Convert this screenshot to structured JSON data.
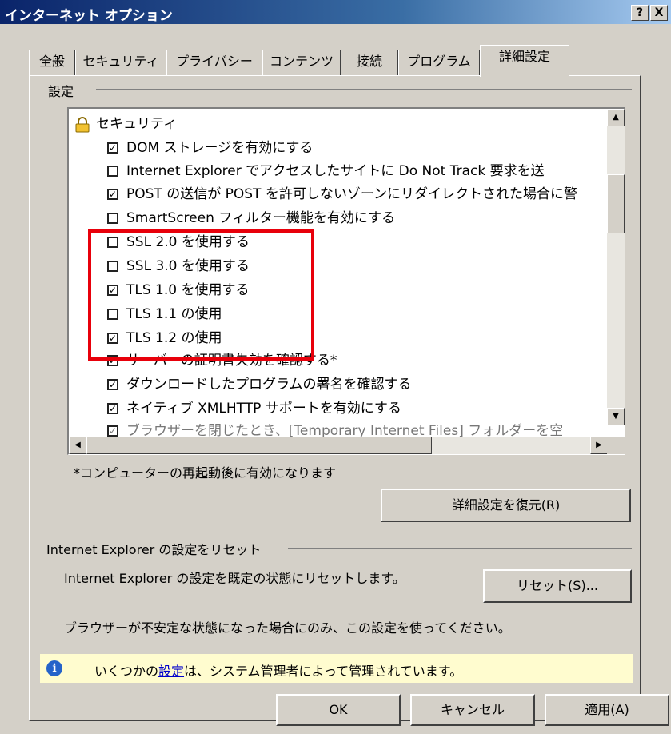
{
  "window": {
    "title": "インターネット オプション",
    "help_button": "?",
    "close_button": "X"
  },
  "tabs": [
    {
      "label": "全般",
      "active": false
    },
    {
      "label": "セキュリティ",
      "active": false
    },
    {
      "label": "プライバシー",
      "active": false
    },
    {
      "label": "コンテンツ",
      "active": false
    },
    {
      "label": "接続",
      "active": false
    },
    {
      "label": "プログラム",
      "active": false
    },
    {
      "label": "詳細設定",
      "active": true
    }
  ],
  "settings_group": {
    "label": "設定",
    "items": [
      {
        "type": "category",
        "label": "セキュリティ",
        "icon": "lock-icon"
      },
      {
        "type": "checkbox",
        "label": "DOM ストレージを有効にする",
        "checked": true
      },
      {
        "type": "checkbox",
        "label": "Internet Explorer でアクセスしたサイトに Do Not Track 要求を送",
        "checked": false
      },
      {
        "type": "checkbox",
        "label": "POST の送信が POST を許可しないゾーンにリダイレクトされた場合に警",
        "checked": true
      },
      {
        "type": "checkbox",
        "label": "SmartScreen フィルター機能を有効にする",
        "checked": false
      },
      {
        "type": "checkbox",
        "label": "SSL 2.0 を使用する",
        "checked": false
      },
      {
        "type": "checkbox",
        "label": "SSL 3.0 を使用する",
        "checked": false
      },
      {
        "type": "checkbox",
        "label": "TLS 1.0 を使用する",
        "checked": true
      },
      {
        "type": "checkbox",
        "label": "TLS 1.1 の使用",
        "checked": false
      },
      {
        "type": "checkbox",
        "label": "TLS 1.2 の使用",
        "checked": true
      },
      {
        "type": "checkbox",
        "label": "サーバーの証明書失効を確認する*",
        "checked": true
      },
      {
        "type": "checkbox",
        "label": "ダウンロードしたプログラムの署名を確認する",
        "checked": true
      },
      {
        "type": "checkbox",
        "label": "ネイティブ XMLHTTP サポートを有効にする",
        "checked": true
      },
      {
        "type": "checkbox",
        "label": "ブラウザーを閉じたとき、[Temporary Internet Files] フォルダーを空",
        "checked": true
      }
    ],
    "restart_note": "*コンピューターの再起動後に有効になります",
    "restore_button": "詳細設定を復元(R)"
  },
  "reset_group": {
    "label": "Internet Explorer の設定をリセット",
    "description": "Internet Explorer の設定を既定の状態にリセットします。",
    "reset_button": "リセット(S)...",
    "warning": "ブラウザーが不安定な状態になった場合にのみ、この設定を使ってください。"
  },
  "info_bar": {
    "prefix": "いくつかの",
    "link": "設定",
    "suffix": "は、システム管理者によって管理されています。"
  },
  "footer": {
    "ok": "OK",
    "cancel": "キャンセル",
    "apply": "適用(A)"
  },
  "colors": {
    "highlight_box": "#e8000b",
    "title_bar": "#0a246a",
    "info_bar_bg": "#fffccf"
  }
}
